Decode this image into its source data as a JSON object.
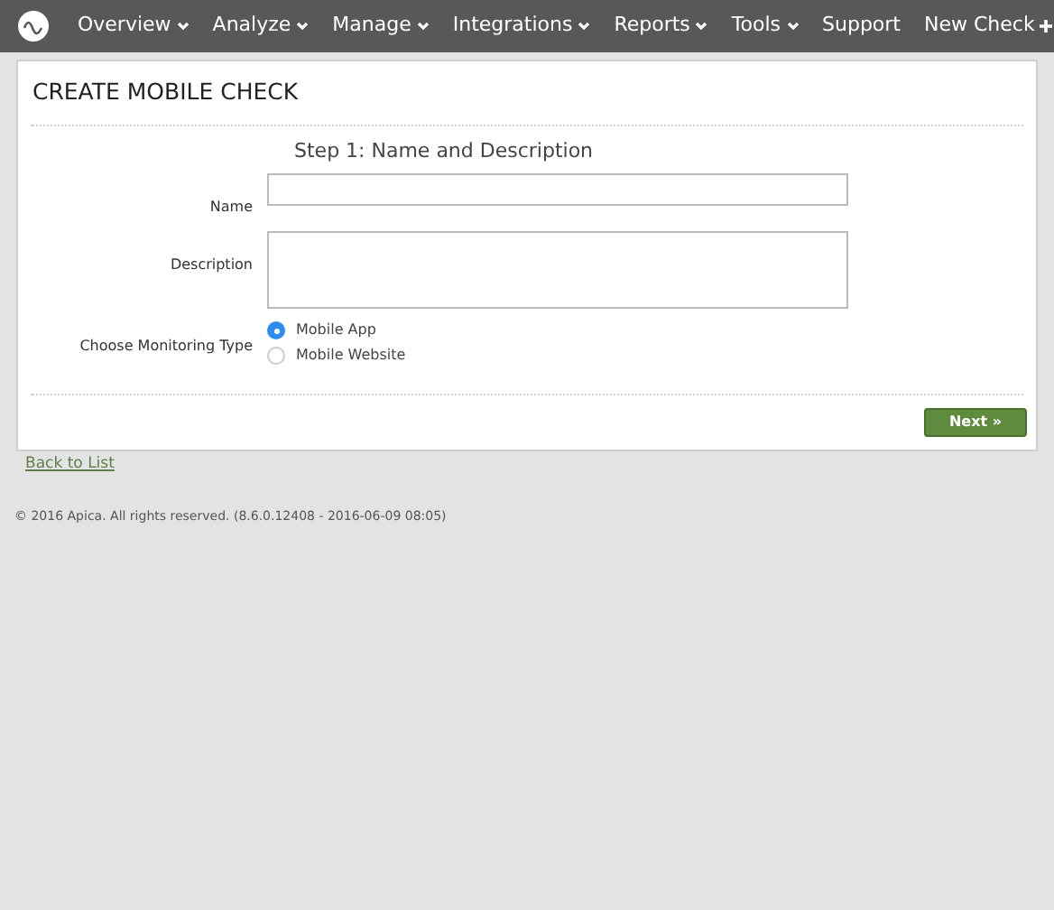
{
  "nav": {
    "items": [
      {
        "label": "Overview",
        "kind": "menu"
      },
      {
        "label": "Analyze",
        "kind": "menu"
      },
      {
        "label": "Manage",
        "kind": "menu"
      },
      {
        "label": "Integrations",
        "kind": "menu"
      },
      {
        "label": "Reports",
        "kind": "menu"
      },
      {
        "label": "Tools",
        "kind": "menu"
      },
      {
        "label": "Support",
        "kind": "link"
      },
      {
        "label": "New Check",
        "kind": "add"
      }
    ]
  },
  "card": {
    "title": "CREATE MOBILE CHECK",
    "step": "Step 1: Name and Description",
    "fields": [
      {
        "label": "Name",
        "kind": "text"
      },
      {
        "label": "Description",
        "kind": "textarea"
      }
    ],
    "monitoring": {
      "label": "Choose Monitoring Type",
      "options": [
        {
          "label": "Mobile App",
          "selected": true
        },
        {
          "label": "Mobile Website",
          "selected": false
        }
      ]
    },
    "next_button": "Next »",
    "back_link": "Back to List"
  },
  "footer": "© 2016 Apica. All rights reserved. (8.6.0.12408 - 2016-06-09 08:05)"
}
